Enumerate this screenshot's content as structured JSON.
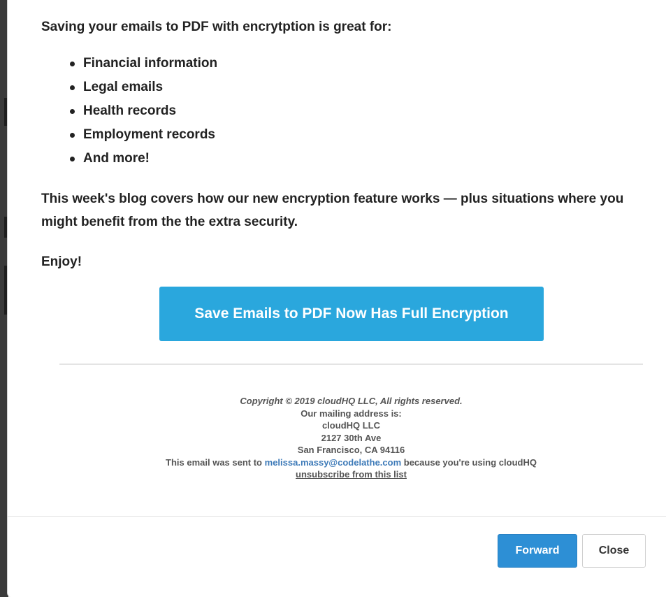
{
  "email": {
    "intro": "Saving your emails to PDF with encrytption is great for:",
    "bullets": [
      "Financial information",
      "Legal emails",
      "Health records",
      "Employment records",
      "And more!"
    ],
    "blog_text": "This week's blog covers how our new encryption feature works — plus situations where you might benefit from the the extra security.",
    "enjoy": "Enjoy!",
    "cta_label": "Save Emails to PDF Now Has Full Encryption",
    "footer": {
      "copyright": "Copyright © 2019 cloudHQ LLC, All rights reserved.",
      "mailing_label": "Our mailing address is:",
      "company": "cloudHQ LLC",
      "street": "2127 30th Ave",
      "city": "San Francisco, CA 94116",
      "sent_to_prefix": "This email was sent to",
      "email_link": "melissa.massy@codelathe.com",
      "sent_to_suffix": "because you're using cloudHQ",
      "unsubscribe": "unsubscribe from this list"
    }
  },
  "dialog": {
    "forward_label": "Forward",
    "close_label": "Close"
  },
  "colors": {
    "cta": "#2aa7dd",
    "forward": "#2d8fd5",
    "link": "#3d7ab8"
  }
}
